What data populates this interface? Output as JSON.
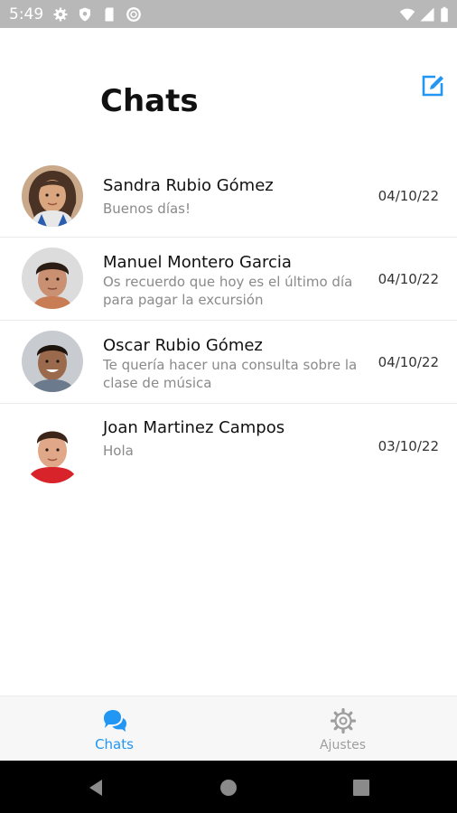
{
  "status_bar": {
    "time": "5:49"
  },
  "header": {
    "title": "Chats"
  },
  "chats": [
    {
      "name": "Sandra Rubio Gómez",
      "message": "Buenos días!",
      "date": "04/10/22"
    },
    {
      "name": "Manuel Montero Garcia",
      "message": "Os recuerdo que hoy es el último día para pagar la excursión",
      "date": "04/10/22"
    },
    {
      "name": "Oscar Rubio Gómez",
      "message": "Te quería hacer una consulta sobre la clase de música",
      "date": "04/10/22"
    },
    {
      "name": "Joan Martinez Campos",
      "message": "Hola",
      "date": "03/10/22"
    }
  ],
  "tabs": [
    {
      "label": "Chats",
      "icon": "chat-bubbles-icon",
      "active": true
    },
    {
      "label": "Ajustes",
      "icon": "gear-icon",
      "active": false
    }
  ],
  "colors": {
    "accent": "#2196f3",
    "inactive": "#9e9e9e",
    "status_bar": "#b8b8b8"
  }
}
